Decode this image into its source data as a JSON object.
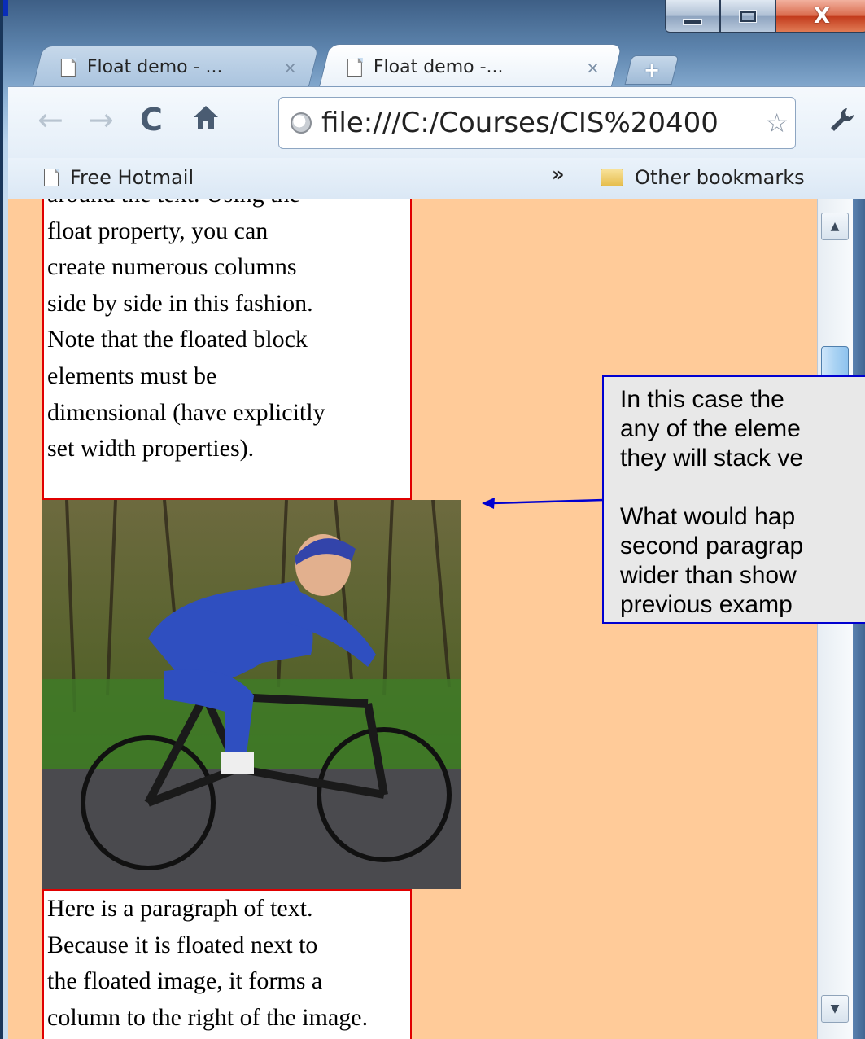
{
  "window": {
    "caption_buttons": {
      "minimize_icon": "minimize-icon",
      "maximize_icon": "maximize-icon",
      "close_icon": "close-icon",
      "close_glyph": "X"
    }
  },
  "tabs": [
    {
      "title": "Float demo - ...",
      "close": "×",
      "active": false
    },
    {
      "title": "Float demo -...",
      "close": "×",
      "active": true
    }
  ],
  "new_tab_glyph": "+",
  "toolbar": {
    "back_glyph": "←",
    "forward_glyph": "→",
    "reload_glyph": "C",
    "home_glyph": "🏠",
    "url": "file:///C:/Courses/CIS%20400",
    "star_glyph": "☆",
    "wrench_glyph": "🔧"
  },
  "bookmarks": {
    "items": [
      {
        "label": "Free Hotmail"
      }
    ],
    "overflow_glyph": "»",
    "other_label": "Other bookmarks"
  },
  "page": {
    "para_top_lines": [
      "around the text. Using the",
      "float property, you can",
      "create numerous columns",
      "side by side in this fashion.",
      "Note that the floated block",
      "elements must be",
      "dimensional (have explicitly",
      "set width properties)."
    ],
    "para_bottom_lines": [
      "Here is a paragraph of text.",
      "Because it is floated next to",
      "the floated image, it forms a",
      "column to the right of the image."
    ],
    "image_name": "cyclist-photo"
  },
  "scrollbar": {
    "up_glyph": "▲",
    "down_glyph": "▼"
  },
  "callout": {
    "lines_a": [
      "In this case the",
      "any of the eleme",
      "they will stack ve"
    ],
    "lines_b": [
      "What would hap",
      "second paragrap",
      "wider than show",
      "previous examp"
    ]
  },
  "colors": {
    "page_background": "#ffcb99",
    "text_box_border": "#e00000",
    "callout_border": "#0000d0",
    "callout_background": "#e8e8e8"
  }
}
